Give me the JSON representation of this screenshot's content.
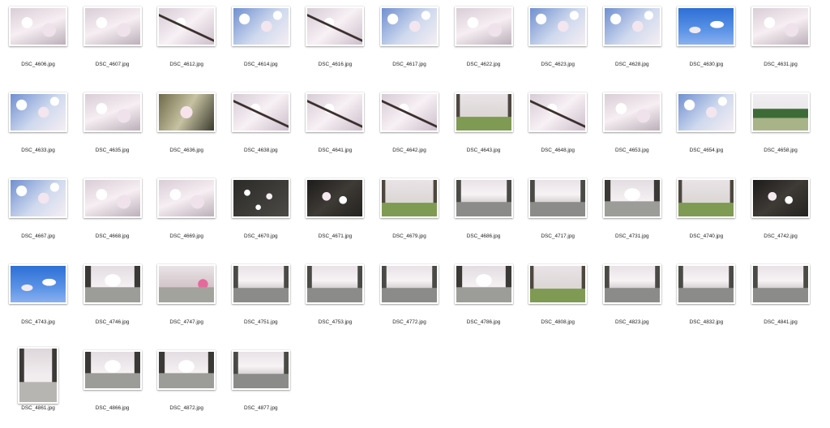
{
  "files": [
    {
      "name": "DSC_4606.jpg",
      "style": "dense-blossom"
    },
    {
      "name": "DSC_4607.jpg",
      "style": "dense-blossom"
    },
    {
      "name": "DSC_4612.jpg",
      "style": "branch-blossom"
    },
    {
      "name": "DSC_4614.jpg",
      "style": "sky-blossom"
    },
    {
      "name": "DSC_4616.jpg",
      "style": "branch-blossom"
    },
    {
      "name": "DSC_4617.jpg",
      "style": "sky-blossom"
    },
    {
      "name": "DSC_4622.jpg",
      "style": "dense-blossom"
    },
    {
      "name": "DSC_4623.jpg",
      "style": "sky-blossom"
    },
    {
      "name": "DSC_4628.jpg",
      "style": "sky-blossom"
    },
    {
      "name": "DSC_4630.jpg",
      "style": "blue-sky"
    },
    {
      "name": "DSC_4631.jpg",
      "style": "dense-blossom"
    },
    {
      "name": "DSC_4633.jpg",
      "style": "sky-blossom"
    },
    {
      "name": "DSC_4635.jpg",
      "style": "dense-blossom"
    },
    {
      "name": "DSC_4636.jpg",
      "style": "closeup"
    },
    {
      "name": "DSC_4638.jpg",
      "style": "branch-blossom"
    },
    {
      "name": "DSC_4641.jpg",
      "style": "branch-blossom"
    },
    {
      "name": "DSC_4642.jpg",
      "style": "branch-blossom"
    },
    {
      "name": "DSC_4643.jpg",
      "style": "green-park"
    },
    {
      "name": "DSC_4648.jpg",
      "style": "branch-blossom"
    },
    {
      "name": "DSC_4653.jpg",
      "style": "dense-blossom"
    },
    {
      "name": "DSC_4654.jpg",
      "style": "sky-blossom"
    },
    {
      "name": "DSC_4658.jpg",
      "style": "hedge"
    },
    {
      "name": "DSC_4667.jpg",
      "style": "sky-blossom"
    },
    {
      "name": "DSC_4668.jpg",
      "style": "dense-blossom"
    },
    {
      "name": "DSC_4669.jpg",
      "style": "dense-blossom"
    },
    {
      "name": "DSC_4670.jpg",
      "style": "petals"
    },
    {
      "name": "DSC_4671.jpg",
      "style": "dark-blossom"
    },
    {
      "name": "DSC_4679.jpg",
      "style": "green-park"
    },
    {
      "name": "DSC_4686.jpg",
      "style": "road"
    },
    {
      "name": "DSC_4717.jpg",
      "style": "road"
    },
    {
      "name": "DSC_4731.jpg",
      "style": "road-bright"
    },
    {
      "name": "DSC_4740.jpg",
      "style": "green-park"
    },
    {
      "name": "DSC_4742.jpg",
      "style": "dark-blossom"
    },
    {
      "name": "DSC_4743.jpg",
      "style": "blue-sky"
    },
    {
      "name": "DSC_4746.jpg",
      "style": "road-bright"
    },
    {
      "name": "DSC_4747.jpg",
      "style": "house"
    },
    {
      "name": "DSC_4751.jpg",
      "style": "road"
    },
    {
      "name": "DSC_4753.jpg",
      "style": "road"
    },
    {
      "name": "DSC_4772.jpg",
      "style": "road"
    },
    {
      "name": "DSC_4786.jpg",
      "style": "road-bright"
    },
    {
      "name": "DSC_4808.jpg",
      "style": "green-park"
    },
    {
      "name": "DSC_4823.jpg",
      "style": "road"
    },
    {
      "name": "DSC_4832.jpg",
      "style": "road"
    },
    {
      "name": "DSC_4841.jpg",
      "style": "road"
    },
    {
      "name": "DSC_4861.jpg",
      "style": "portrait-road",
      "orientation": "portrait"
    },
    {
      "name": "DSC_4866.jpg",
      "style": "road-bright"
    },
    {
      "name": "DSC_4872.jpg",
      "style": "road-bright"
    },
    {
      "name": "DSC_4877.jpg",
      "style": "road"
    }
  ]
}
